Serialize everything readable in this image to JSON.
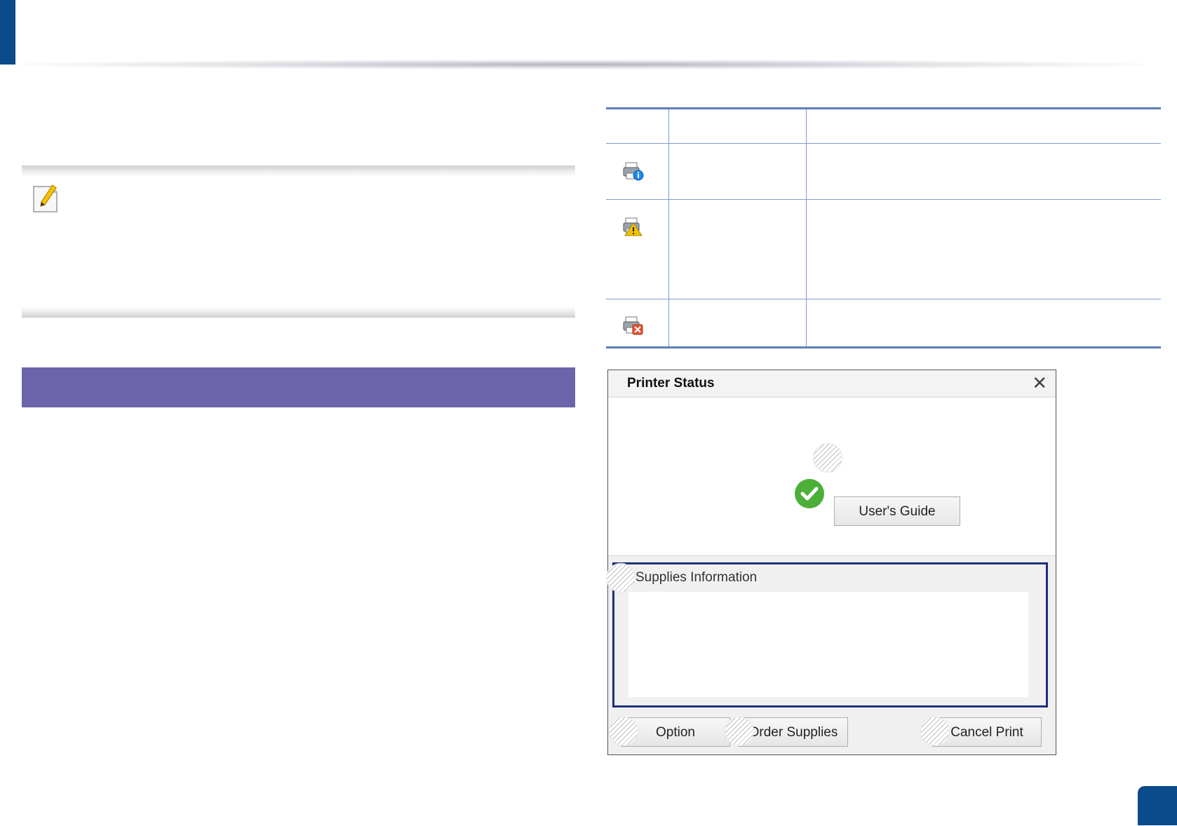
{
  "dialog": {
    "title": "Printer Status",
    "close_glyph": "✕",
    "users_guide_label": "User's Guide",
    "supplies_label": "Supplies Information",
    "option_label": "Option",
    "order_supplies_label": "Order Supplies",
    "cancel_print_label": "Cancel Print",
    "status_icon": "check-circle-icon"
  },
  "status_table": {
    "rows": [
      {
        "icon": "printer-info-icon",
        "accent": "#1e88e5"
      },
      {
        "icon": "printer-warning-icon",
        "accent": "#f2c200"
      },
      {
        "icon": "printer-error-icon",
        "accent": "#e8542c"
      }
    ]
  },
  "colors": {
    "brand_blue": "#0b4a8b",
    "section_bar": "#6c64ab",
    "table_line": "#5a7fb4",
    "ok_green": "#4caf3a",
    "supplies_frame": "#1f2f7a"
  }
}
